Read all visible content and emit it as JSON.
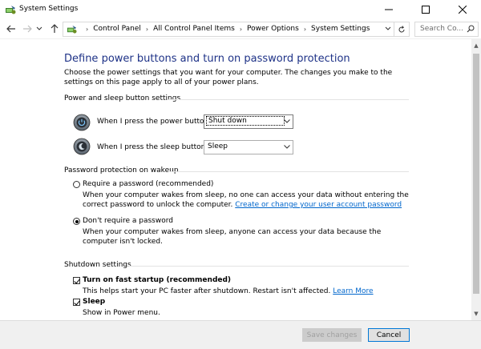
{
  "window": {
    "title": "System Settings",
    "minimize_glyph": "—",
    "maximize_glyph": "☐",
    "close_glyph": "✕"
  },
  "nav": {
    "back_glyph": "←",
    "forward_glyph": "→",
    "recent_glyph": "⌄",
    "up_glyph": "↑"
  },
  "address": {
    "crumbs": [
      "Control Panel",
      "All Control Panel Items",
      "Power Options",
      "System Settings"
    ],
    "separator": "›"
  },
  "search": {
    "placeholder": "Search Co..."
  },
  "page": {
    "heading": "Define power buttons and turn on password protection",
    "intro": "Choose the power settings that you want for your computer. The changes you make to the settings on this page apply to all of your power plans."
  },
  "power_section": {
    "title": "Power and sleep button settings",
    "power_button": {
      "label": "When I press the power button:",
      "value": "Shut down"
    },
    "sleep_button": {
      "label": "When I press the sleep button:",
      "value": "Sleep"
    }
  },
  "password_section": {
    "title": "Password protection on wakeup",
    "require": {
      "label": "Require a password (recommended)",
      "desc": "When your computer wakes from sleep, no one can access your data without entering the correct password to unlock the computer.",
      "link": "Create or change your user account password",
      "selected": false
    },
    "dont_require": {
      "label": "Don't require a password",
      "desc": "When your computer wakes from sleep, anyone can access your data because the computer isn't locked.",
      "selected": true
    }
  },
  "shutdown_section": {
    "title": "Shutdown settings",
    "fast_startup": {
      "label": "Turn on fast startup (recommended)",
      "desc": "This helps start your PC faster after shutdown. Restart isn't affected.",
      "link": "Learn More",
      "checked": true
    },
    "sleep": {
      "label": "Sleep",
      "desc": "Show in Power menu.",
      "checked": true
    }
  },
  "footer": {
    "save_label": "Save changes",
    "cancel_label": "Cancel"
  },
  "colors": {
    "heading": "#1e3287",
    "link": "#0066cc",
    "footer_bg": "#f0f0f0"
  }
}
